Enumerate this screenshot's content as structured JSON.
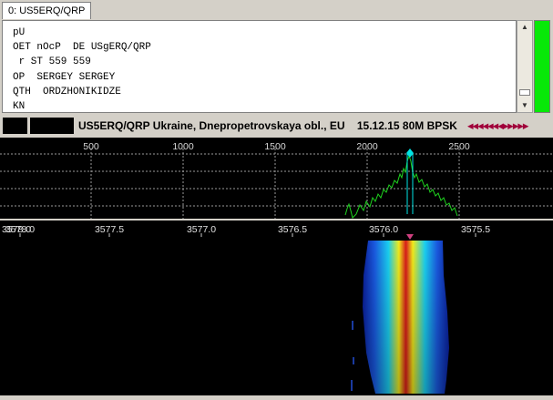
{
  "tab": {
    "label": "0: US5ERQ/QRP"
  },
  "rx_text": "pU\nOET nOcP  DE USgERQ/QRP\n r ST 559 559\nOP  SERGEY SERGEY\nQTH  ORDZHONIKIDZE\nKN",
  "scrollbar": {
    "up_glyph": "▲",
    "down_glyph": "▼"
  },
  "info": {
    "text": "US5ERQ/QRP Ukraine, Dnepropetrovskaya obl., EU    15.12.15 80M BPSK",
    "nav_glyphs": "◀◀◀◀◀◀◀▶▶▶▶▶",
    "colors": {
      "nav": "#a0003a",
      "level": "#08e808"
    }
  },
  "spectrum": {
    "audio_ticks": [
      "500",
      "1000",
      "1500",
      "2000",
      "2500"
    ],
    "colors": {
      "trace": "#1fd41f",
      "grid": "#9a9a9a",
      "marker": "#00e5e5",
      "labels": "#d8d8d8"
    }
  },
  "waterfall": {
    "freq_ticks": [
      "3578.0",
      "3577.5",
      "3577.0",
      "3576.5",
      "3576.0",
      "3575.5"
    ],
    "overlap_label": "3578.0",
    "colors": {
      "signal_core": "#d81a1a",
      "signal_mid": "#f2ea1a",
      "signal_edge": "#1a5ae0",
      "marker": "#d04080"
    }
  }
}
